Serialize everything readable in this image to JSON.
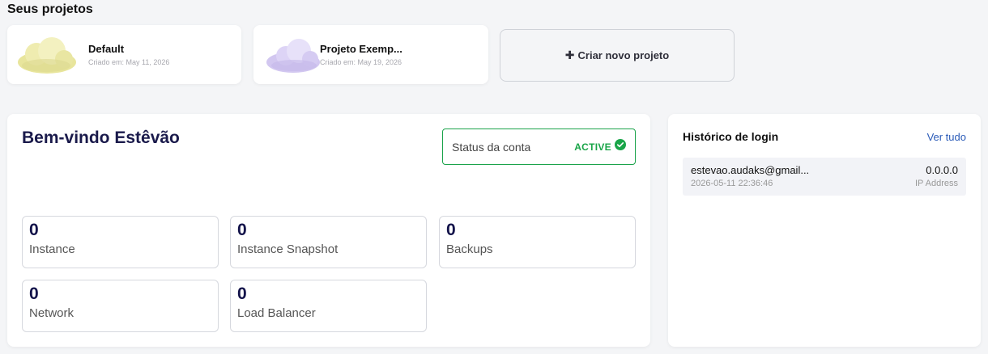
{
  "projects_section": {
    "title": "Seus projetos"
  },
  "projects": [
    {
      "name": "Default",
      "created": "Criado em: May 11, 2026",
      "icon": "cloud-icon",
      "color": "#ece9a4"
    },
    {
      "name": "Projeto Exemp...",
      "created": "Criado em: May 19, 2026",
      "icon": "cloud-icon",
      "color": "#d7cdf3"
    }
  ],
  "new_project": {
    "label": "Criar novo projeto",
    "icon": "plus-icon"
  },
  "welcome": {
    "title": "Bem-vindo Estêvão",
    "status_label": "Status da conta",
    "status_value": "ACTIVE",
    "status_color": "#19a548"
  },
  "stats": [
    {
      "value": "0",
      "label": "Instance"
    },
    {
      "value": "0",
      "label": "Instance Snapshot"
    },
    {
      "value": "0",
      "label": "Backups"
    },
    {
      "value": "0",
      "label": "Network"
    },
    {
      "value": "0",
      "label": "Load Balancer"
    }
  ],
  "login_history": {
    "title": "Histórico de login",
    "see_all": "Ver tudo",
    "entries": [
      {
        "email": "estevao.audaks@gmail...",
        "time": "2026-05-11 22:36:46",
        "ip": "0.0.0.0",
        "ip_label": "IP Address"
      }
    ]
  }
}
